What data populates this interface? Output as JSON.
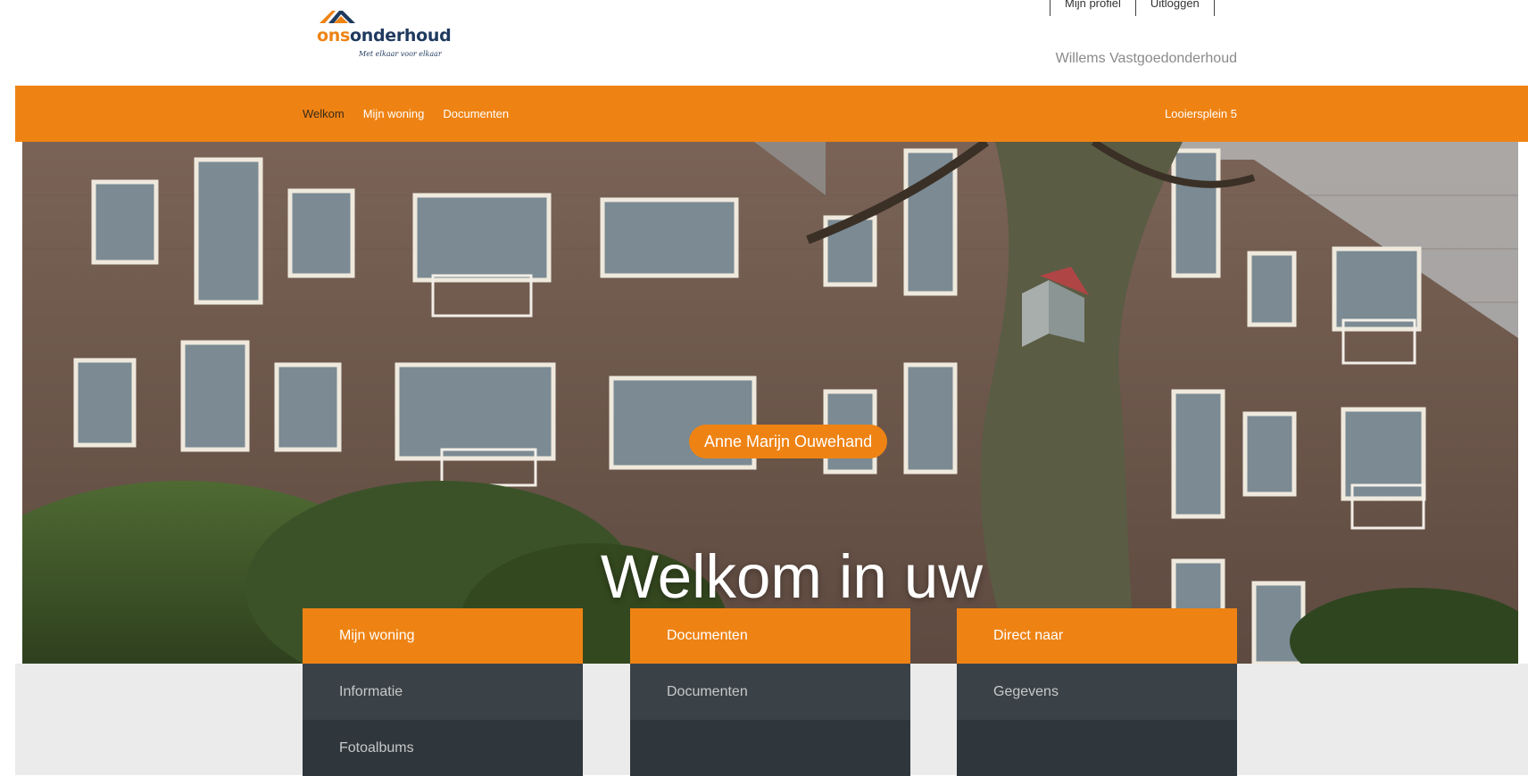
{
  "brand": {
    "logo_ons": "ons",
    "logo_onderhoud": "onderhoud",
    "tagline": "Met elkaar voor elkaar",
    "orange": "#ee8314",
    "navy": "#1f3a5f"
  },
  "header": {
    "profile_link": "Mijn profiel",
    "logout_link": "Uitloggen",
    "company_name": "Willems Vastgoedonderhoud"
  },
  "nav": {
    "items": [
      {
        "label": "Welkom",
        "active": true
      },
      {
        "label": "Mijn woning",
        "active": false
      },
      {
        "label": "Documenten",
        "active": false
      }
    ],
    "address": "Looiersplein 5"
  },
  "hero": {
    "resident_name": "Anne Marijn Ouwehand",
    "title": "Welkom in uw dossier"
  },
  "cards": [
    {
      "title": "Mijn woning",
      "items": [
        "Informatie",
        "Fotoalbums"
      ]
    },
    {
      "title": "Documenten",
      "items": [
        "Documenten",
        ""
      ]
    },
    {
      "title": "Direct naar",
      "items": [
        "Gegevens",
        ""
      ]
    }
  ]
}
